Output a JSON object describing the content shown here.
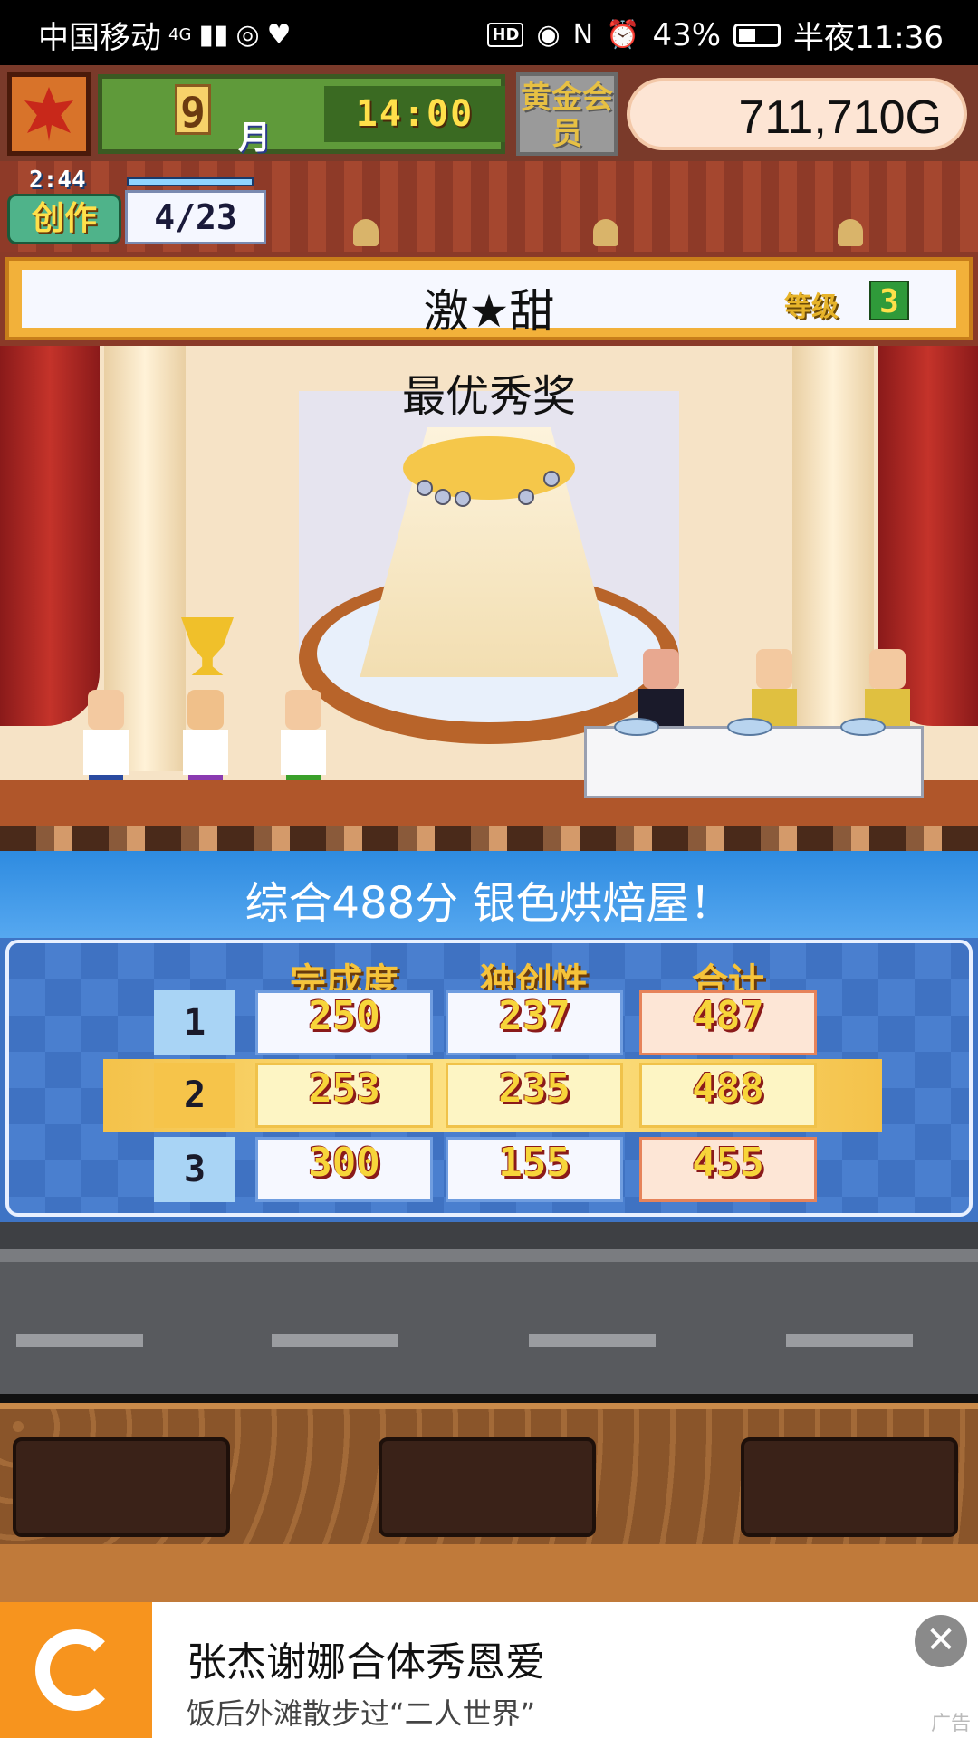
{
  "status_bar": {
    "carrier": "中国移动",
    "signal": "4G",
    "battery": "43%",
    "time_period": "半夜",
    "time": "11:36"
  },
  "hud": {
    "month_num": "9",
    "month_label": "月",
    "clock": "14:00",
    "membership": "黄金会员",
    "money": "711,710",
    "currency": "G"
  },
  "creation": {
    "timer": "2:44",
    "label": "创作",
    "count": "4/23"
  },
  "dish": {
    "name": "激★甜",
    "grade_label": "等级",
    "grade": "3",
    "award": "最优秀奖"
  },
  "result": {
    "headline": "综合488分 银色烘焙屋！",
    "columns": [
      "完成度",
      "独创性",
      "合计"
    ],
    "rows": [
      {
        "rank": "1",
        "completion": "250",
        "originality": "237",
        "total": "487"
      },
      {
        "rank": "2",
        "completion": "253",
        "originality": "235",
        "total": "488"
      },
      {
        "rank": "3",
        "completion": "300",
        "originality": "155",
        "total": "455"
      }
    ]
  },
  "ad": {
    "title": "张杰谢娜合体秀恩爱",
    "subtitle": "饭后外滩散步过“二人世界”",
    "close_glyph": "✕",
    "tag": "广告"
  },
  "colors": {
    "accent_gold": "#f2b13a",
    "panel_blue": "#3e74c5",
    "ad_orange": "#f7941e"
  }
}
